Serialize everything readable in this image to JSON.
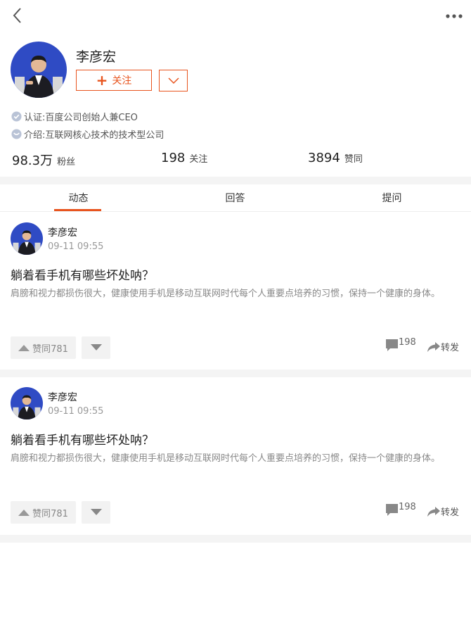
{
  "header": {
    "back_icon": "chevron-left-icon",
    "more_icon": "more-dots-icon"
  },
  "profile": {
    "name": "李彦宏",
    "follow_label": "关注",
    "verified_text": "认证:百度公司创始人兼CEO",
    "intro_text": "介绍:互联网核心技术的技术型公司",
    "stats": [
      {
        "value": "98.3万",
        "label": "粉丝"
      },
      {
        "value": "198",
        "label": "关注"
      },
      {
        "value": "3894",
        "label": "赞同"
      }
    ]
  },
  "tabs": [
    {
      "label": "动态",
      "active": true
    },
    {
      "label": "回答",
      "active": false
    },
    {
      "label": "提问",
      "active": false
    }
  ],
  "posts": [
    {
      "author": "李彦宏",
      "time": "09-11 09:55",
      "title": "躺着看手机有哪些坏处呐？",
      "body": "肩膀和视力都损伤很大，健康使用手机是移动互联网时代每个人重要点培养的习惯，保持一个健康的身体。",
      "like_label": "赞同781",
      "comment_count": "198",
      "share_label": "转发"
    },
    {
      "author": "李彦宏",
      "time": "09-11 09:55",
      "title": "躺着看手机有哪些坏处呐？",
      "body": "肩膀和视力都损伤很大，健康使用手机是移动互联网时代每个人重要点培养的习惯，保持一个健康的身体。",
      "like_label": "赞同781",
      "comment_count": "198",
      "share_label": "转发"
    }
  ],
  "colors": {
    "accent": "#e8541e",
    "muted": "#999999",
    "band": "#f4f4f4",
    "avatar_bg": "#2f4bc4"
  }
}
